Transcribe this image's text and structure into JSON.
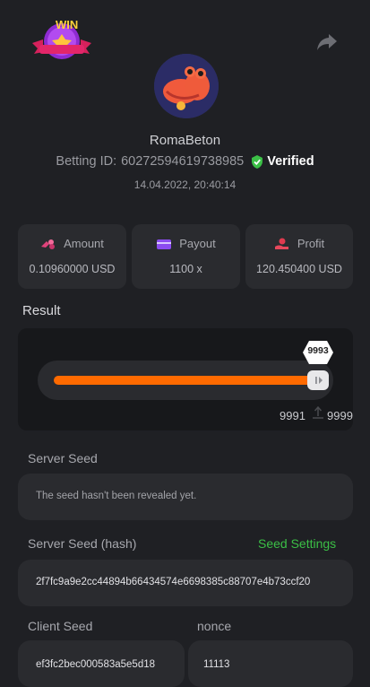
{
  "header": {
    "badge_text": "WIN",
    "badge_icon": "win-badge-icon",
    "share_icon": "share-icon",
    "avatar_icon": "crocodile-avatar-icon"
  },
  "user": {
    "username": "RomaBeton",
    "betting_id_label": "Betting ID:",
    "betting_id": "60272594619738985",
    "verified_label": "Verified",
    "timestamp": "14.04.2022, 20:40:14"
  },
  "stats": [
    {
      "label": "Amount",
      "value": "0.10960000 USD",
      "icon": "coins-icon"
    },
    {
      "label": "Payout",
      "value": "1100 x",
      "icon": "card-icon"
    },
    {
      "label": "Profit",
      "value": "120.450400 USD",
      "icon": "hand-coin-icon"
    }
  ],
  "result": {
    "label": "Result",
    "marker_value": "9993",
    "fill_fraction": 0.9993,
    "range_left": "9991",
    "range_right": "9999"
  },
  "seeds": {
    "server_seed_label": "Server Seed",
    "server_seed_text": "The seed hasn't been revealed yet.",
    "hash_label": "Server Seed (hash)",
    "seed_settings_label": "Seed Settings",
    "hash_value": "2f7fc9a9e2cc44894b66434574e6698385c88707e4b73ccf20",
    "client_seed_label": "Client Seed",
    "client_seed_value": "ef3fc2bec000583a5e5d18",
    "nonce_label": "nonce",
    "nonce_value": "11113"
  },
  "colors": {
    "accent_orange": "#ff6a00",
    "verified_green": "#3bbf46",
    "background": "#1f2024",
    "card": "#2a2b2f"
  }
}
